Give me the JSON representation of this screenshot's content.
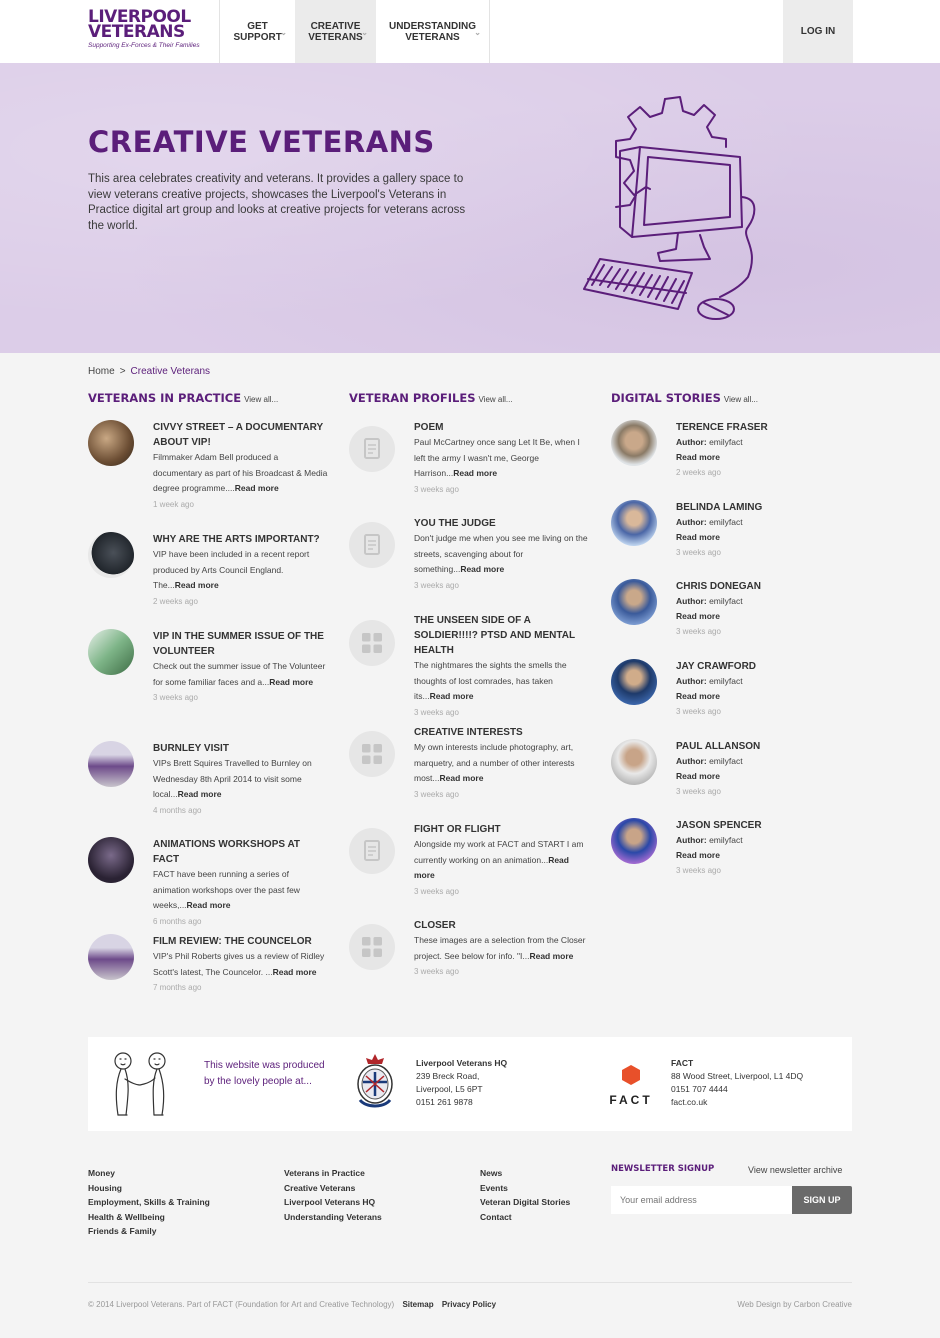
{
  "header": {
    "logo": {
      "line1": "LIVERPOOL",
      "line2": "VETERANS",
      "tagline": "Supporting Ex-Forces & Their Families"
    },
    "nav": [
      {
        "label": "GET SUPPORT"
      },
      {
        "label": "CREATIVE VETERANS"
      },
      {
        "label": "UNDERSTANDING VETERANS"
      }
    ],
    "login": "LOG IN"
  },
  "hero": {
    "title": "CREATIVE VETERANS",
    "text": "This area celebrates creativity and veterans. It provides a gallery space to view veterans creative projects, showcases the Liverpool's Veterans in Practice digital art group and looks at creative projects for veterans across the world."
  },
  "breadcrumb": {
    "home": "Home",
    "sep": ">",
    "current": "Creative Veterans"
  },
  "columns": [
    {
      "title": "VETERANS IN PRACTICE",
      "view_all": "View all...",
      "items": [
        {
          "title": "CIVVY STREET – A DOCUMENTARY ABOUT VIP!",
          "excerpt": "Filmmaker Adam Bell produced a documentary as part of his Broadcast & Media degree programme....",
          "more": "Read more",
          "ago": "1 week ago"
        },
        {
          "title": "WHY ARE THE ARTS IMPORTANT?",
          "excerpt": "VIP have been included in a recent report produced by Arts Council England. The...",
          "more": "Read more",
          "ago": "2 weeks ago"
        },
        {
          "title": "VIP IN THE SUMMER ISSUE OF THE VOLUNTEER",
          "excerpt": "Check out the summer issue of The Volunteer for some familiar faces and a...",
          "more": "Read more",
          "ago": "3 weeks ago"
        },
        {
          "title": "BURNLEY VISIT",
          "excerpt": "VIPs Brett Squires Travelled to Burnley on Wednesday 8th April 2014 to visit some local...",
          "more": "Read more",
          "ago": "4 months ago"
        },
        {
          "title": "ANIMATIONS WORKSHOPS AT FACT",
          "excerpt": "FACT have been running a series of animation workshops over the past few weeks,...",
          "more": "Read more",
          "ago": "6 months ago"
        },
        {
          "title": "FILM REVIEW: THE COUNCELOR",
          "excerpt": "VIP's Phil Roberts gives us a review of Ridley Scott's latest, The Councelor. ...",
          "more": "Read more",
          "ago": "7 months ago"
        }
      ]
    },
    {
      "title": "VETERAN PROFILES",
      "view_all": "View all...",
      "items": [
        {
          "title": "POEM",
          "excerpt": "Paul McCartney once sang Let It Be, when I left the army I wasn't me, George Harrison...",
          "more": "Read more",
          "ago": "3 weeks ago"
        },
        {
          "title": "YOU THE JUDGE",
          "excerpt": "Don't judge me when you see me living on the streets, scavenging about for something...",
          "more": "Read more",
          "ago": "3 weeks ago"
        },
        {
          "title": "THE UNSEEN SIDE OF A SOLDIER!!!!? PTSD AND MENTAL HEALTH",
          "excerpt": "The nightmares the sights the smells the thoughts of lost comrades, has taken its...",
          "more": "Read more",
          "ago": "3 weeks ago"
        },
        {
          "title": "CREATIVE INTERESTS",
          "excerpt": "My own interests include photography, art, marquetry, and a number of other interests most...",
          "more": "Read more",
          "ago": "3 weeks ago"
        },
        {
          "title": "FIGHT OR FLIGHT",
          "excerpt": "Alongside my work at FACT and START I am currently working on an animation...",
          "more": "Read more",
          "ago": "3 weeks ago"
        },
        {
          "title": "CLOSER",
          "excerpt": "These images are a selection from the Closer project. See below for info. \"I...",
          "more": "Read more",
          "ago": "3 weeks ago"
        }
      ]
    },
    {
      "title": "DIGITAL STORIES",
      "view_all": "View all...",
      "items": [
        {
          "title": "TERENCE FRASER",
          "author_label": "Author:",
          "author": "emilyfact",
          "more": "Read more",
          "ago": "2 weeks ago"
        },
        {
          "title": "BELINDA LAMING",
          "author_label": "Author:",
          "author": "emilyfact",
          "more": "Read more",
          "ago": "3 weeks ago"
        },
        {
          "title": "CHRIS DONEGAN",
          "author_label": "Author:",
          "author": "emilyfact",
          "more": "Read more",
          "ago": "3 weeks ago"
        },
        {
          "title": "JAY CRAWFORD",
          "author_label": "Author:",
          "author": "emilyfact",
          "more": "Read more",
          "ago": "3 weeks ago"
        },
        {
          "title": "PAUL ALLANSON",
          "author_label": "Author:",
          "author": "emilyfact",
          "more": "Read more",
          "ago": "3 weeks ago"
        },
        {
          "title": "JASON SPENCER",
          "author_label": "Author:",
          "author": "emilyfact",
          "more": "Read more",
          "ago": "3 weeks ago"
        }
      ]
    }
  ],
  "credits": {
    "text": "This website was produced by the lovely people at...",
    "hq": {
      "name": "Liverpool Veterans HQ",
      "line1": "239 Breck Road,",
      "line2": "Liverpool, L5 6PT",
      "phone": "0151 261 9878"
    },
    "fact": {
      "name": "FACT",
      "line1": "88 Wood Street, Liverpool, L1 4DQ",
      "phone": "0151 707 4444",
      "url": "fact.co.uk",
      "logo_word": "FACT"
    }
  },
  "footer": {
    "col1": [
      "Money",
      "Housing",
      "Employment, Skills & Training",
      "Health & Wellbeing",
      "Friends & Family"
    ],
    "col2": [
      "Veterans in Practice",
      "Creative Veterans",
      "Liverpool Veterans HQ",
      "Understanding Veterans"
    ],
    "col3": [
      "News",
      "Events",
      "Veteran Digital Stories",
      "Contact"
    ],
    "newsletter": {
      "title": "NEWSLETTER SIGNUP",
      "archive": "View newsletter archive",
      "placeholder": "Your email address",
      "button": "SIGN UP"
    },
    "copyright": "© 2014 Liverpool Veterans. Part of FACT (Foundation for Art and Creative Technology)",
    "sitemap": "Sitemap",
    "privacy": "Privacy Policy",
    "credit": "Web Design by Carbon Creative"
  },
  "colors": {
    "brand": "#5b1e7a",
    "hero": "#dccde8",
    "background": "#f4f4f4"
  },
  "icons": [
    "chevron-down-icon",
    "document-icon",
    "gallery-icon",
    "computer-gear-illustration",
    "handshake-illustration",
    "crest-logo",
    "fact-hexagon-logo"
  ]
}
